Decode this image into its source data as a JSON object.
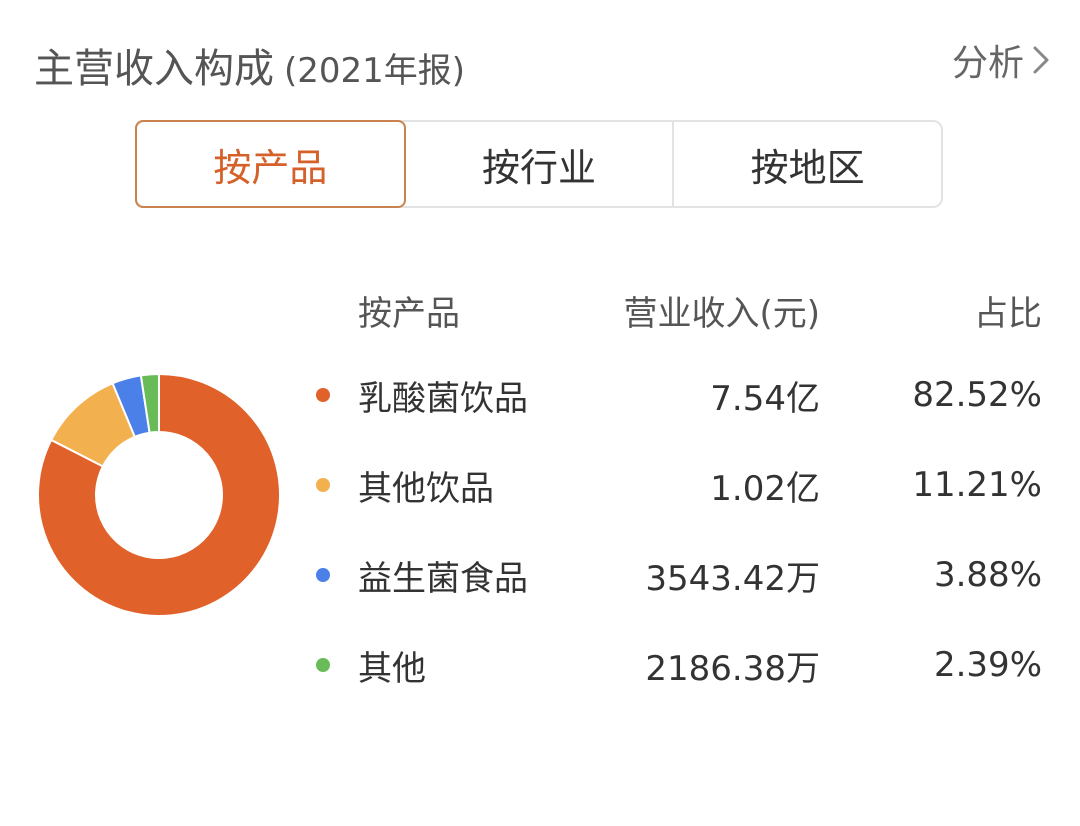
{
  "header": {
    "title": "主营收入构成",
    "title_suffix": "(2021年报)",
    "analysis_label": "分析",
    "analysis_icon": "chevron-right-icon"
  },
  "tabs": [
    {
      "label": "按产品",
      "active": true
    },
    {
      "label": "按行业",
      "active": false
    },
    {
      "label": "按地区",
      "active": false
    }
  ],
  "colors": {
    "accent": "#d6602a",
    "series": [
      "#e0622a",
      "#f3b04f",
      "#4a80e8",
      "#69bb58"
    ]
  },
  "table": {
    "headers": {
      "name": "按产品",
      "revenue": "营业收入(元)",
      "share": "占比"
    },
    "rows": [
      {
        "name": "乳酸菌饮品",
        "revenue": "7.54亿",
        "share": "82.52%"
      },
      {
        "name": "其他饮品",
        "revenue": "1.02亿",
        "share": "11.21%"
      },
      {
        "name": "益生菌食品",
        "revenue": "3543.42万",
        "share": "3.88%"
      },
      {
        "name": "其他",
        "revenue": "2186.38万",
        "share": "2.39%"
      }
    ]
  },
  "chart_data": {
    "type": "pie",
    "style": "donut",
    "categories": [
      "乳酸菌饮品",
      "其他饮品",
      "益生菌食品",
      "其他"
    ],
    "values": [
      82.52,
      11.21,
      3.88,
      2.39
    ],
    "colors": [
      "#e0622a",
      "#f3b04f",
      "#4a80e8",
      "#69bb58"
    ]
  }
}
